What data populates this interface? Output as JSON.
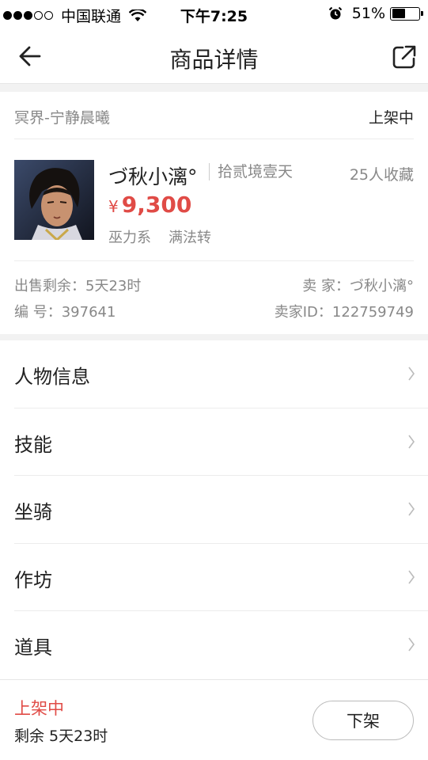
{
  "status_bar": {
    "carrier": "中国联通",
    "time": "下午7:25",
    "battery": "51%",
    "battery_level": 0.51
  },
  "nav": {
    "title": "商品详情"
  },
  "product": {
    "server": "冥界-宁静晨曦",
    "listing_status": "上架中",
    "name": "づ秋小漓°",
    "realm": "拾贰境壹天",
    "favorites": "25人收藏",
    "currency": "¥",
    "price": "9,300",
    "tags": [
      "巫力系",
      "满法转"
    ],
    "remaining_label": "出售剩余：",
    "remaining_value": "5天23时",
    "seller_label": "卖 家：",
    "seller_value": "づ秋小漓°",
    "serial_label": "编 号：",
    "serial_value": "397641",
    "seller_id_label": "卖家ID：",
    "seller_id_value": "122759749"
  },
  "sections": [
    {
      "label": "人物信息"
    },
    {
      "label": "技能"
    },
    {
      "label": "坐骑"
    },
    {
      "label": "作坊"
    },
    {
      "label": "道具"
    }
  ],
  "footer": {
    "status": "上架中",
    "remaining": "剩余 5天23时",
    "offshelf_label": "下架"
  },
  "colors": {
    "accent_red": "#e04b46",
    "muted_text": "#888888",
    "divider": "#ececec",
    "gap_gray": "#f2f2f2"
  },
  "icons": {
    "back": "back-arrow-icon",
    "share": "share-external-icon",
    "chevron": "chevron-right-icon",
    "wifi": "wifi-icon",
    "alarm": "alarm-icon",
    "battery": "battery-icon"
  }
}
